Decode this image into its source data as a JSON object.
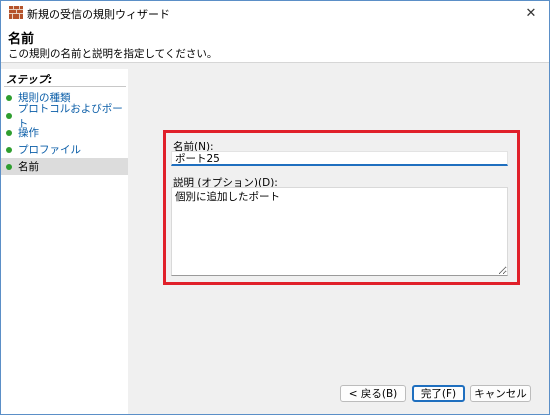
{
  "window": {
    "title": "新規の受信の規則ウィザード",
    "close_glyph": "✕"
  },
  "header": {
    "title": "名前",
    "subtitle": "この規則の名前と説明を指定してください。"
  },
  "steps": {
    "heading": "ステップ:",
    "items": [
      {
        "label": "規則の種類"
      },
      {
        "label": "プロトコルおよびポート"
      },
      {
        "label": "操作"
      },
      {
        "label": "プロファイル"
      },
      {
        "label": "名前"
      }
    ],
    "current_index": 4,
    "dot_color": "#2f9e2f"
  },
  "form": {
    "name_label": "名前(N):",
    "name_value": "ポート25",
    "description_label": "説明 (オプション)(D):",
    "description_value": "個別に追加したポート"
  },
  "buttons": {
    "back": "< 戻る(B)",
    "finish": "完了(F)",
    "cancel": "キャンセル"
  },
  "colors": {
    "highlight_border": "#e0202a",
    "accent": "#1f6fbf",
    "link": "#0b5ea8"
  }
}
